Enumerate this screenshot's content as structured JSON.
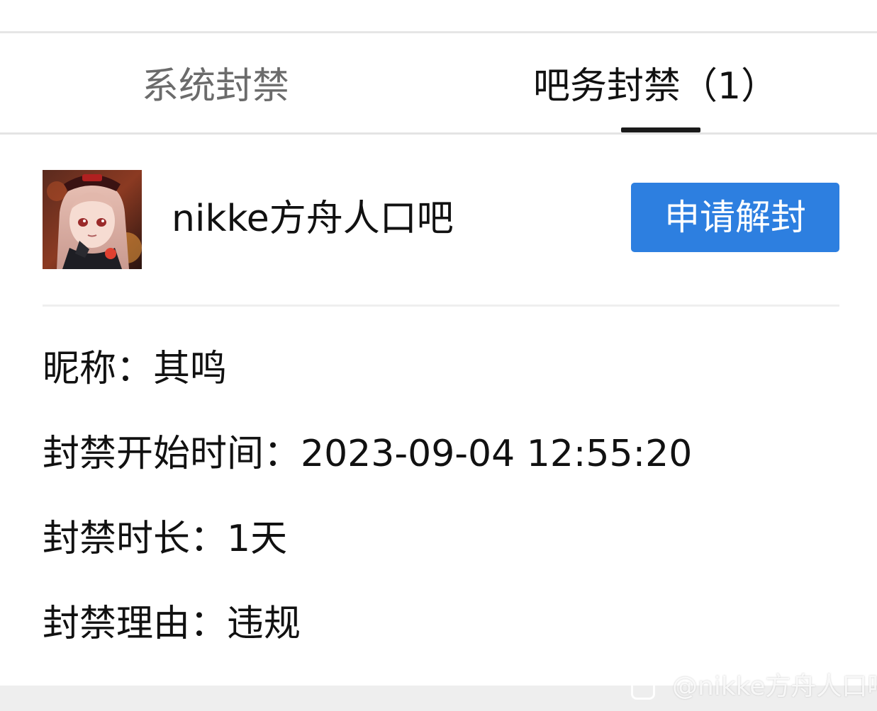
{
  "tabs": [
    {
      "label": "系统封禁",
      "active": false
    },
    {
      "label": "吧务封禁（1）",
      "active": true
    }
  ],
  "ban_record": {
    "forum_name": "nikke方舟人口吧",
    "unban_button_label": "申请解封",
    "nickname_label": "昵称：",
    "nickname_value": "其鸣",
    "start_time_label": "封禁开始时间：",
    "start_time_value": "2023-09-04 12:55:20",
    "duration_label": "封禁时长：",
    "duration_value": "1天",
    "reason_label": "封禁理由：",
    "reason_value": "违规"
  },
  "watermark": {
    "text": "@nikke方舟人口吧"
  },
  "colors": {
    "accent_button": "#2d7fe0",
    "active_tab_text": "#111111",
    "inactive_tab_text": "#6b6b6b",
    "tab_underline": "#1a1a1a"
  },
  "icons": {
    "avatar": "forum-avatar-anime-girl"
  }
}
